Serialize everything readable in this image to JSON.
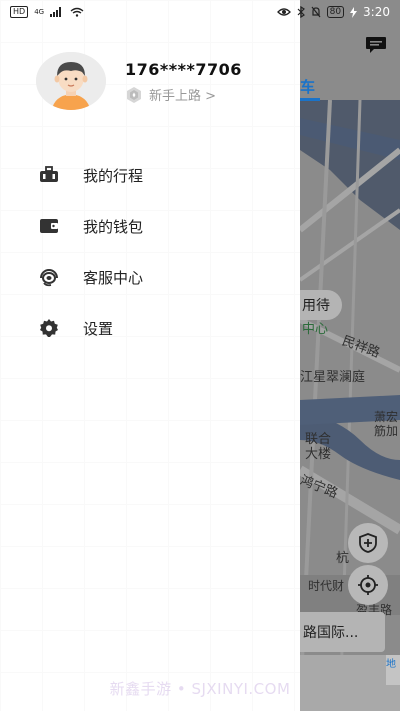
{
  "status_bar": {
    "hd": "HD",
    "signal": "4G",
    "battery": "80",
    "time": "3:20"
  },
  "profile": {
    "phone": "176****7706",
    "level": "新手上路 >"
  },
  "menu": {
    "items": [
      {
        "label": "我的行程",
        "icon": "luggage-icon"
      },
      {
        "label": "我的钱包",
        "icon": "wallet-icon"
      },
      {
        "label": "客服中心",
        "icon": "headset-icon"
      },
      {
        "label": "设置",
        "icon": "gear-icon"
      }
    ]
  },
  "map": {
    "tab_label": "车",
    "wait_label": "用待",
    "labels": [
      "中心",
      "民祥路",
      "江星翠澜庭",
      "萧宏",
      "筋加",
      "联合",
      "大楼",
      "鸿宁路",
      "杭",
      "时代财",
      "盈丰路"
    ],
    "bottom_card": "路国际...",
    "corner_label": "地"
  },
  "watermark": "新鑫手游 • SJXINYI.COM",
  "colors": {
    "accent": "#1a73c9",
    "map_water": "#4a6fa5"
  }
}
